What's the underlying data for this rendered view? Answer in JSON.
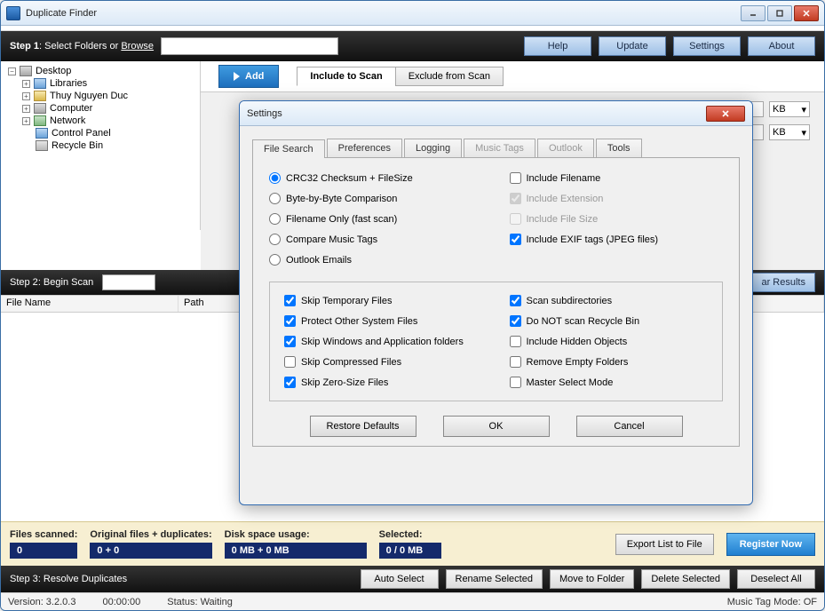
{
  "window": {
    "title": "Duplicate Finder"
  },
  "step1": {
    "label": "Step 1",
    "text": ": Select Folders or ",
    "browse": "Browse",
    "help": "Help",
    "update": "Update",
    "settings": "Settings",
    "about": "About"
  },
  "tree": {
    "root": "Desktop",
    "items": [
      "Libraries",
      "Thuy Nguyen Duc",
      "Computer",
      "Network",
      "Control Panel",
      "Recycle Bin"
    ]
  },
  "addbtn": "Add",
  "tabs": {
    "include": "Include to Scan",
    "exclude": "Exclude from Scan"
  },
  "kb": "KB",
  "step2": {
    "label": "Step 2",
    "text": ": Begin Scan",
    "results_tab": "ar Results"
  },
  "columns": {
    "filename": "File Name",
    "path": "Path"
  },
  "stats": {
    "files_scanned_label": "Files scanned:",
    "files_scanned_value": "0",
    "orig_label": "Original files + duplicates:",
    "orig_value": "0 + 0",
    "disk_label": "Disk space usage:",
    "disk_value": "0 MB + 0 MB",
    "selected_label": "Selected:",
    "selected_value": "0 / 0 MB",
    "export": "Export List to File",
    "register": "Register Now"
  },
  "step3": {
    "label": "Step 3",
    "text": ": Resolve Duplicates",
    "auto_select": "Auto Select",
    "rename": "Rename Selected",
    "move": "Move to Folder",
    "delete": "Delete Selected",
    "deselect": "Deselect All"
  },
  "status": {
    "version": "Version: 3.2.0.3",
    "elapsed": "00:00:00",
    "state": "Status: Waiting",
    "music": "Music Tag Mode: OF"
  },
  "settings_dialog": {
    "title": "Settings",
    "tabs": {
      "file_search": "File Search",
      "preferences": "Preferences",
      "logging": "Logging",
      "music_tags": "Music Tags",
      "outlook": "Outlook",
      "tools": "Tools"
    },
    "radios": {
      "crc": "CRC32 Checksum + FileSize",
      "byte": "Byte-by-Byte Comparison",
      "filename": "Filename Only (fast scan)",
      "music": "Compare Music Tags",
      "outlook_emails": "Outlook Emails"
    },
    "right_checks": {
      "include_filename": "Include Filename",
      "include_extension": "Include Extension",
      "include_filesize": "Include File Size",
      "include_exif": "Include EXIF tags (JPEG files)"
    },
    "lower_left": {
      "skip_temp": "Skip Temporary Files",
      "protect_sys": "Protect Other System Files",
      "skip_win": "Skip Windows and Application folders",
      "skip_compressed": "Skip Compressed Files",
      "skip_zero": "Skip Zero-Size Files"
    },
    "lower_right": {
      "scan_subdirs": "Scan subdirectories",
      "no_recycle": "Do NOT scan Recycle Bin",
      "include_hidden": "Include Hidden Objects",
      "remove_empty": "Remove Empty Folders",
      "master_select": "Master Select Mode"
    },
    "buttons": {
      "restore": "Restore Defaults",
      "ok": "OK",
      "cancel": "Cancel"
    }
  }
}
